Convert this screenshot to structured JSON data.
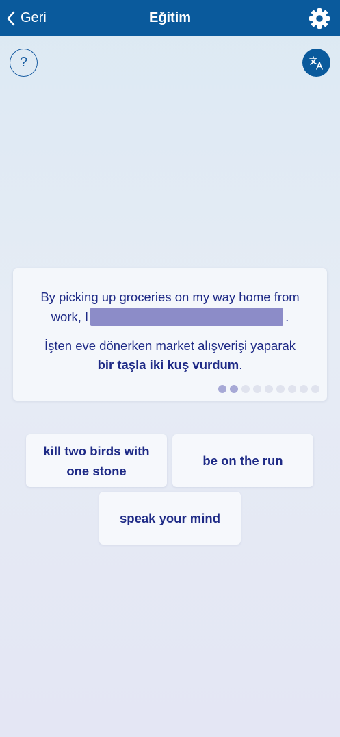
{
  "header": {
    "back_label": "Geri",
    "title": "Eğitim",
    "settings_icon": "gear-icon",
    "background_color": "#0a5a9c"
  },
  "toolbar": {
    "help_symbol": "?",
    "help_icon": "question-icon",
    "translate_icon": "translate-icon"
  },
  "exercise": {
    "sentence_before": "By picking up groceries on my way home from work, I",
    "sentence_after": ".",
    "translation_before": "İşten eve dönerken market alışverişi yaparak",
    "translation_bold": "bir taşla iki kuş vurdum",
    "translation_after": ".",
    "progress": {
      "completed": 2,
      "total": 9
    }
  },
  "options": [
    {
      "label": "kill two birds with one stone"
    },
    {
      "label": "be on the run"
    },
    {
      "label": "speak your mind"
    }
  ],
  "colors": {
    "accent": "#0a5a9c",
    "text": "#1e2a86",
    "blank": "#8c8cc8",
    "dot_completed": "#a7a9d6",
    "dot_pending": "#e0e3ee"
  }
}
